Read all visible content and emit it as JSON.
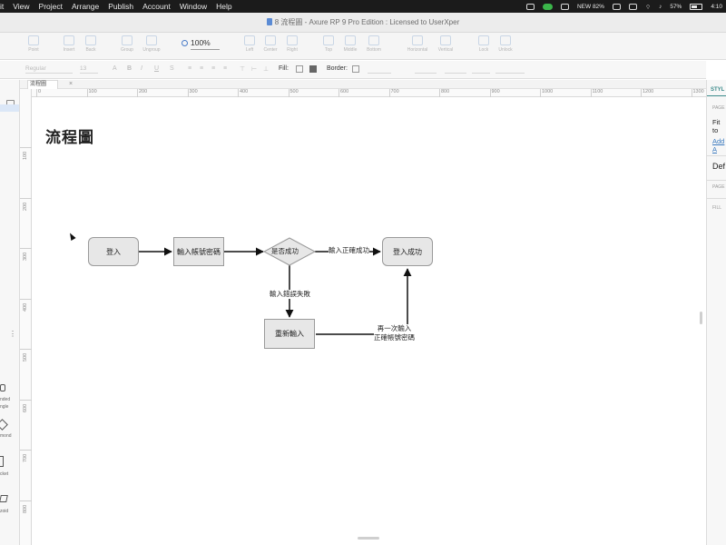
{
  "menubar": {
    "items": [
      "it",
      "View",
      "Project",
      "Arrange",
      "Publish",
      "Account",
      "Window",
      "Help"
    ],
    "status_text": "NEW 82%",
    "battery": "57%",
    "time": "4:10"
  },
  "window": {
    "title": "8 流程圖 - Axure RP 9 Pro Edition : Licensed to UserXper"
  },
  "toolbar": {
    "items": [
      "Point",
      "Insert",
      "Back",
      "Group",
      "Ungroup",
      "Left",
      "Center",
      "Right",
      "Top",
      "Middle",
      "Bottom",
      "Horizontal",
      "Vertical",
      "Lock",
      "Unlock"
    ],
    "zoom": "100%"
  },
  "stylebar": {
    "font_weight": "Regular",
    "font_size": "13",
    "fill_label": "Fill:",
    "border_label": "Border:"
  },
  "tabs": {
    "active": "流程圖",
    "close": "×"
  },
  "rulers": {
    "h_labels": [
      "0",
      "100",
      "200",
      "300",
      "400",
      "500",
      "600",
      "700",
      "800",
      "900",
      "1000",
      "1100",
      "1200",
      "1300"
    ],
    "v_labels": [
      "100",
      "200",
      "300",
      "400",
      "500",
      "600",
      "700",
      "800",
      "900"
    ]
  },
  "canvas": {
    "page_title": "流程圖",
    "nodes": {
      "login": "登入",
      "enter_credentials": "輸入帳號密碼",
      "check_success": "是否成功",
      "login_success": "登入成功",
      "reenter": "重新輸入"
    },
    "edges": {
      "correct": "輸入正確成功",
      "error": "輸入錯誤失敗",
      "retry_line1": "再一次輸入",
      "retry_line2": "正確帳號密碼"
    }
  },
  "left_panel": {
    "shape_labels": [
      "nded",
      "ngle",
      "mond",
      "cket",
      "zoid"
    ]
  },
  "right_panel": {
    "tab": "STYL",
    "page_label": "PAGE",
    "fit_label": "Fit to",
    "add_label": "Add A",
    "default_label": "Def",
    "page_label2": "PAGE",
    "fill_label": "FILL"
  }
}
